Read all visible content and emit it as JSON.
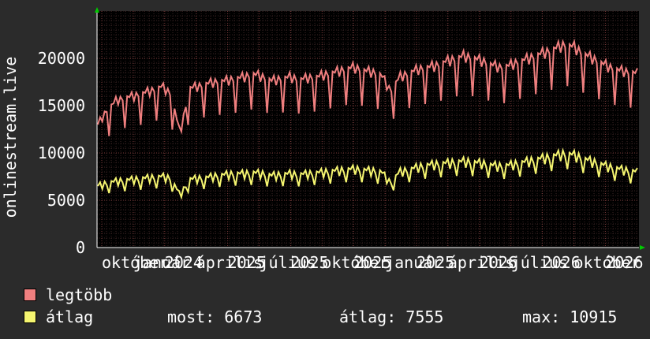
{
  "chart_data": {
    "type": "line",
    "ylabel": "onlinestream.live",
    "ylim": [
      0,
      25000
    ],
    "yticks": [
      "0",
      "5000",
      "10000",
      "15000",
      "20000"
    ],
    "x_tick_labels": [
      "október",
      "január",
      "2024",
      "április",
      "2025",
      "július",
      "2025",
      "október",
      "2025",
      "január",
      "2025",
      "április",
      "2026",
      "július",
      "2026",
      "október",
      "2026"
    ],
    "grid": true,
    "background_color": "#000000",
    "series": [
      {
        "name": "legtöbb",
        "color": "#f07f7f",
        "base": [
          13000,
          14500,
          15500,
          15800,
          16000,
          16300,
          16600,
          17000,
          16200,
          12000,
          16800,
          17000,
          17300,
          17500,
          17600,
          17800,
          18000,
          18300,
          18000,
          17600,
          17800,
          18000,
          17700,
          17900,
          18000,
          18300,
          18500,
          18800,
          19000,
          18700,
          18500,
          18200,
          16500,
          18000,
          18400,
          18800,
          19000,
          19200,
          19600,
          19900,
          20200,
          20000,
          19700,
          19300,
          19000,
          19200,
          19600,
          19900,
          20300,
          20600,
          21000,
          21400,
          21200,
          20500,
          20000,
          19500,
          19000,
          18700,
          18500,
          18400
        ]
      },
      {
        "name": "átlag",
        "color": "#f5f570",
        "base": [
          6500,
          6800,
          7000,
          7100,
          7200,
          7300,
          7400,
          7500,
          7300,
          5500,
          7200,
          7300,
          7400,
          7600,
          7700,
          7800,
          7800,
          7900,
          7800,
          7600,
          7700,
          7800,
          7700,
          7800,
          7900,
          8000,
          8100,
          8200,
          8300,
          8200,
          8100,
          8000,
          6800,
          8000,
          8200,
          8500,
          8700,
          8800,
          8900,
          9000,
          9100,
          9000,
          8900,
          8700,
          8600,
          8700,
          8900,
          9100,
          9300,
          9500,
          9700,
          9900,
          9800,
          9400,
          9100,
          8800,
          8500,
          8300,
          8100,
          8000
        ]
      }
    ]
  },
  "legend": [
    {
      "label": "legtöbb",
      "color": "#f07f7f"
    },
    {
      "label": "átlag",
      "color": "#f5f570"
    }
  ],
  "stats": {
    "most": "most: 6673",
    "atlag": "átlag: 7555",
    "max": "max: 10915"
  }
}
